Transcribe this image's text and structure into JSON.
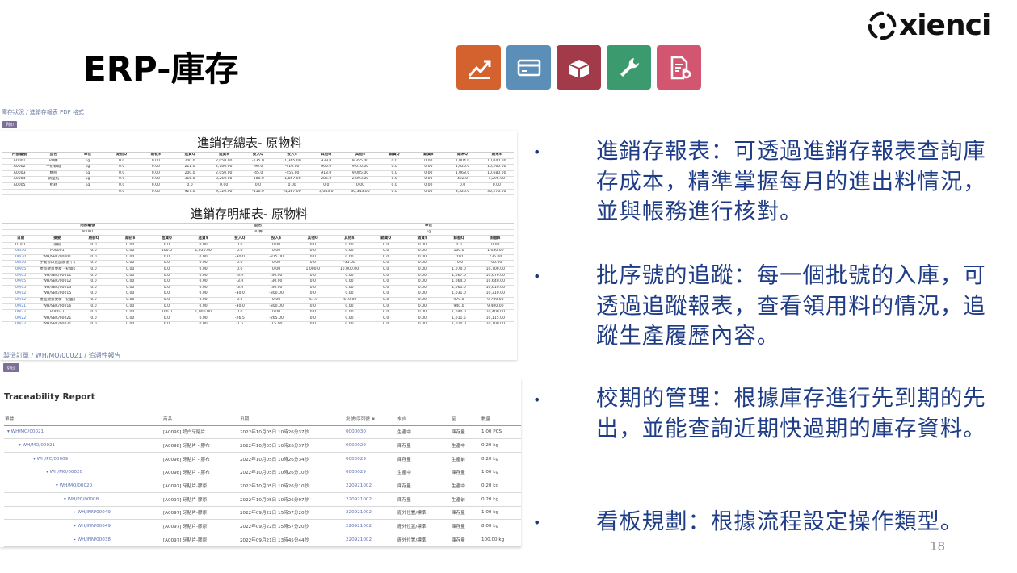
{
  "logo": {
    "text": "xienci"
  },
  "slide": {
    "title": "ERP-庫存",
    "page_number": "18"
  },
  "app_icons": [
    {
      "name": "reporting-icon",
      "color": "#d3622f"
    },
    {
      "name": "accounting-icon",
      "color": "#5c8fb8"
    },
    {
      "name": "inventory-icon",
      "color": "#a33a49"
    },
    {
      "name": "settings-icon",
      "color": "#3b9b6e"
    },
    {
      "name": "document-settings-icon",
      "color": "#d2566f"
    }
  ],
  "shot1": {
    "breadcrumb": "庫存狀況 / 進銷存報表 PDF 格式",
    "print_label": "列印",
    "summary": {
      "title": "進銷存總表- 原物料",
      "headers": [
        "內部編號",
        "品名",
        "單位",
        "期初Q",
        "期初$",
        "進貨Q",
        "進貨$",
        "投入Q",
        "投入$",
        "其他Q",
        "其他$",
        "銷貨Q",
        "銷貨$",
        "期末Q",
        "期末$"
      ],
      "rows": [
        [
          "A0001",
          "PU棒",
          "kg",
          "0.0",
          "0.00",
          "200.0",
          "2,050.00",
          "-135.0",
          "-1,365.00",
          "939.0",
          "9,355.00",
          "0.0",
          "0.00",
          "1,004.0",
          "10,040.00"
        ],
        [
          "A0002",
          "牛奶軟糖",
          "kg",
          "0.0",
          "0.00",
          "211.0",
          "2,160.00",
          "-90.0",
          "-910.00",
          "905.0",
          "9,010.00",
          "0.0",
          "0.00",
          "1,026.0",
          "10,260.00"
        ],
        [
          "A0003",
          "糖膠",
          "kg",
          "0.0",
          "0.00",
          "200.0",
          "2,050.00",
          "-45.0",
          "-455.00",
          "913.0",
          "9,085.00",
          "0.0",
          "0.00",
          "1,068.0",
          "10,680.00"
        ],
        [
          "A0004",
          "鋼型紙",
          "kg",
          "0.0",
          "0.00",
          "316.0",
          "3,260.00",
          "-180.0",
          "-1,857.00",
          "286.0",
          "2,893.00",
          "0.0",
          "0.00",
          "422.0",
          "4,296.00"
        ],
        [
          "A0005",
          "折耗",
          "kg",
          "0.0",
          "0.00",
          "0.0",
          "0.00",
          "0.0",
          "0.00",
          "0.0",
          "0.00",
          "0.0",
          "0.00",
          "0.0",
          "0.00"
        ],
        [
          "",
          "",
          "",
          "0.0",
          "0.00",
          "927.0",
          "9,520.00",
          "-450.0",
          "-4,587.00",
          "3,043.0",
          "30,343.00",
          "0.0",
          "0.00",
          "3,520.0",
          "35,276.00"
        ]
      ]
    },
    "detail": {
      "title": "進銷存明細表- 原物料",
      "meta_headers": [
        "內部編號",
        "品名",
        "單位"
      ],
      "meta_values": [
        "A0001",
        "PU棒",
        "kg"
      ],
      "headers": [
        "日期",
        "摘要",
        "期初Q",
        "期初$",
        "進貨Q",
        "進貨$",
        "投入Q",
        "投入$",
        "其他Q",
        "其他$",
        "銷貨Q",
        "銷貨$",
        "餘額Q",
        "餘額$"
      ],
      "rows": [
        [
          "01/01",
          "期初",
          "0.0",
          "0.00",
          "0.0",
          "0.00",
          "0.0",
          "0.00",
          "0.0",
          "0.00",
          "0.0",
          "0.00",
          "0.0",
          "0.00"
        ],
        [
          "08/30",
          "P00001",
          "0.0",
          "0.00",
          "100.0",
          "1,050.00",
          "0.0",
          "0.00",
          "0.0",
          "0.00",
          "0.0",
          "0.00",
          "100.0",
          "1,050.00"
        ],
        [
          "08/30",
          "WH/SBC/00001",
          "0.0",
          "0.00",
          "0.0",
          "0.00",
          "-30.0",
          "-315.00",
          "0.0",
          "0.00",
          "0.0",
          "0.00",
          "70.0",
          "735.00"
        ],
        [
          "08/30",
          "手動修改產品價值 ( 從 10.5 到 10.0 )",
          "0.0",
          "0.00",
          "0.0",
          "0.00",
          "0.0",
          "0.00",
          "0.0",
          "-35.00",
          "0.0",
          "0.00",
          "70.0",
          "700.00"
        ],
        [
          "09/05",
          "產品數量更新 - 初盤點",
          "0.0",
          "0.00",
          "0.0",
          "0.00",
          "0.0",
          "0.00",
          "1,000.0",
          "10,000.00",
          "0.0",
          "0.00",
          "1,070.0",
          "10,700.00"
        ],
        [
          "09/05",
          "WH/SBC/00011",
          "0.0",
          "0.00",
          "0.0",
          "0.00",
          "-3.0",
          "-30.00",
          "0.0",
          "0.00",
          "0.0",
          "0.00",
          "1,067.0",
          "10,670.00"
        ],
        [
          "09/05",
          "WH/SBC/00012",
          "0.0",
          "0.00",
          "0.0",
          "0.00",
          "-3.0",
          "-30.00",
          "0.0",
          "0.00",
          "0.0",
          "0.00",
          "1,064.0",
          "10,640.00"
        ],
        [
          "09/05",
          "WH/SBC/00013",
          "0.0",
          "0.00",
          "0.0",
          "0.00",
          "-3.0",
          "-30.00",
          "0.0",
          "0.00",
          "0.0",
          "0.00",
          "1,061.0",
          "10,610.00"
        ],
        [
          "09/12",
          "WH/SBC/00015",
          "0.0",
          "0.00",
          "0.0",
          "0.00",
          "-30.0",
          "-300.00",
          "0.0",
          "0.00",
          "0.0",
          "0.00",
          "1,031.0",
          "10,310.00"
        ],
        [
          "09/12",
          "產品數量更新 - 初盤點",
          "0.0",
          "0.00",
          "0.0",
          "0.00",
          "0.0",
          "0.00",
          "-61.0",
          "-610.00",
          "0.0",
          "0.00",
          "970.0",
          "9,700.00"
        ],
        [
          "09/21",
          "WH/SBC/00016",
          "0.0",
          "0.00",
          "0.0",
          "0.00",
          "-30.0",
          "-300.00",
          "0.0",
          "0.00",
          "0.0",
          "0.00",
          "940.0",
          "9,400.00"
        ],
        [
          "09/22",
          "P00037",
          "0.0",
          "0.00",
          "100.0",
          "1,000.00",
          "0.0",
          "0.00",
          "0.0",
          "0.00",
          "0.0",
          "0.00",
          "1,040.0",
          "10,400.00"
        ],
        [
          "09/22",
          "WH/SBC/00021",
          "0.0",
          "0.00",
          "0.0",
          "0.00",
          "-26.5",
          "-265.00",
          "0.0",
          "0.00",
          "0.0",
          "0.00",
          "1,011.5",
          "10,115.00"
        ],
        [
          "09/22",
          "WH/SBC/00021",
          "0.0",
          "0.00",
          "0.0",
          "0.00",
          "-1.5",
          "-15.00",
          "0.0",
          "0.00",
          "0.0",
          "0.00",
          "1,010.0",
          "10,100.00"
        ]
      ]
    }
  },
  "shot2": {
    "breadcrumb": "製造訂單 / WH/MO/00021 / 追溯性報告",
    "print_label": "列印",
    "title": "Traceability Report",
    "headers": [
      "單據",
      "商品",
      "日期",
      "批號/序列號 #",
      "來自",
      "至",
      "數量"
    ],
    "rows": [
      [
        "▾ WH/MO/00021",
        "[A0099] 奶白牙貼片",
        "2022年10月05日 10時26分37秒",
        "0000030",
        "生產中",
        "庫存量",
        "1.00 PCS"
      ],
      [
        "▾ WH/MO/00021",
        "[A0098] 牙貼片 - 膠布",
        "2022年10月05日 10時26分37秒",
        "0000029",
        "庫存量",
        "生產中",
        "0.20 kg"
      ],
      [
        "▾ WH/PC/00009",
        "[A0098] 牙貼片 - 膠布",
        "2022年10月05日 10時26分34秒",
        "0000029",
        "庫存量",
        "生產前",
        "0.20 kg"
      ],
      [
        "▾ WH/MO/00020",
        "[A0098] 牙貼片 - 膠布",
        "2022年10月05日 10時26分10秒",
        "0000029",
        "生產中",
        "庫存量",
        "1.00 kg"
      ],
      [
        "▾ WH/MO/00020",
        "[A0097] 牙貼片-膠原",
        "2022年10月05日 10時26分10秒",
        "220921002",
        "庫存量",
        "生產中",
        "0.20 kg"
      ],
      [
        "▾ WH/PC/00008",
        "[A0097] 牙貼片-膠原",
        "2022年10月05日 10時26分07秒",
        "220921002",
        "庫存量",
        "生產前",
        "0.20 kg"
      ],
      [
        "▸ WH/INN/00049",
        "[A0097] 牙貼片-膠原",
        "2022年09月22日 15時57分20秒",
        "220921002",
        "廠外位置/標準",
        "庫存量",
        "1.00 kg"
      ],
      [
        "▸ WH/INN/00049",
        "[A0097] 牙貼片-膠原",
        "2022年09月22日 15時57分20秒",
        "220921002",
        "廠外位置/標準",
        "庫存量",
        "8.00 kg"
      ],
      [
        "▸ WH/INN/00038",
        "[A0097] 牙貼片-膠原",
        "2022年09月21日 13時45分44秒",
        "220921002",
        "廠外位置/標準",
        "庫存量",
        "100.00 kg"
      ]
    ]
  },
  "bullets": [
    {
      "dot": "•",
      "text": "進銷存報表：可透過進銷存報表查詢庫存成本，精準掌握每月的進出料情況，並與帳務進行核對。"
    },
    {
      "dot": "•",
      "text": "批序號的追蹤：每一個批號的入庫，可透過追蹤報表，查看領用料的情況，追蹤生產履歷內容。"
    },
    {
      "dot": "•",
      "text": "校期的管理：根據庫存進行先到期的先出，並能查詢近期快過期的庫存資料。"
    },
    {
      "dot": "•",
      "text": "看板規劃：根據流程設定操作類型。"
    }
  ]
}
